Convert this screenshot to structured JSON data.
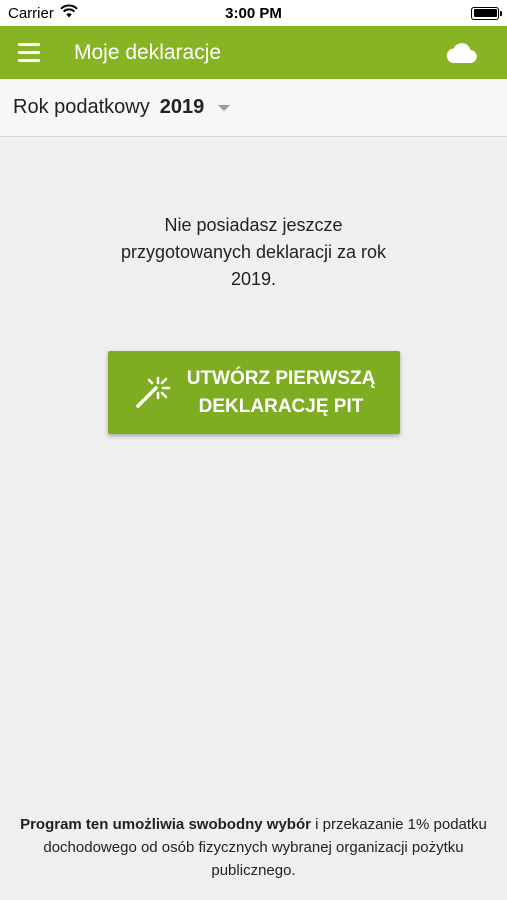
{
  "status_bar": {
    "carrier": "Carrier",
    "time": "3:00 PM",
    "icons": [
      "wifi-icon",
      "battery-icon"
    ]
  },
  "app_bar": {
    "title": "Moje deklaracje",
    "color": "#86b424",
    "icons": [
      "menu-icon",
      "cloud-icon"
    ]
  },
  "year_selector": {
    "label": "Rok podatkowy",
    "value": "2019"
  },
  "empty_state": {
    "message": "Nie posiadasz jeszcze przygotowanych deklaracji za rok 2019."
  },
  "create_button": {
    "line1": "UTWÓRZ PIERWSZĄ",
    "line2": "DEKLARACJĘ PIT",
    "icon": "magic-wand-icon",
    "color": "#7fad22"
  },
  "footer": {
    "bold": "Program ten umożliwia swobodny wybór",
    "rest": " i przekazanie 1% podatku dochodowego od osób fizycznych wybranej organizacji pożytku publicznego."
  }
}
